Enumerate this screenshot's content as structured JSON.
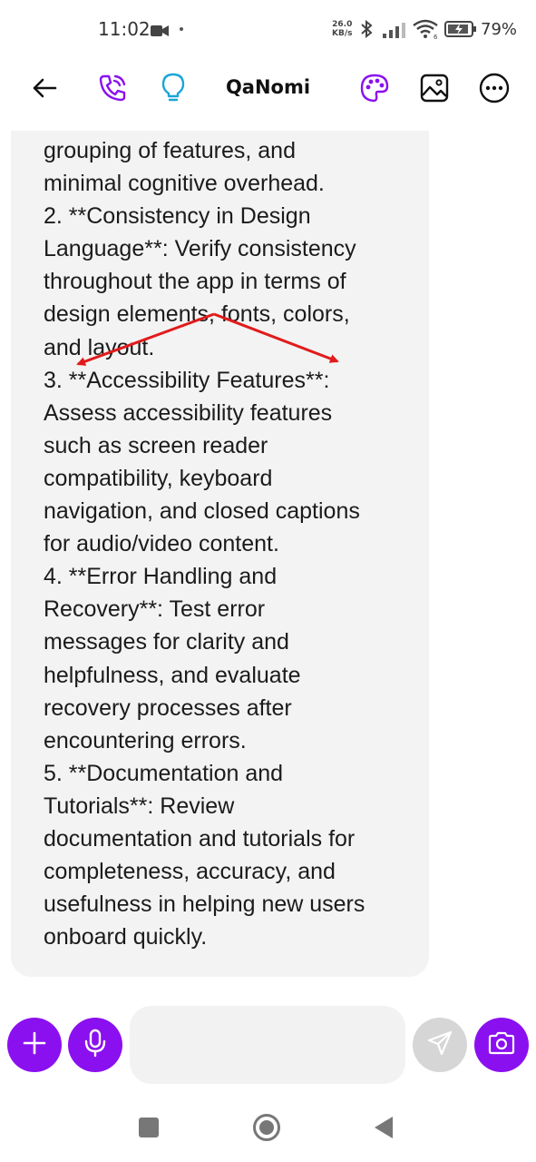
{
  "status_bar": {
    "time": "11:02",
    "net_speed_value": "26.0",
    "net_speed_unit": "KB/s",
    "battery_percent": "79%"
  },
  "app_bar": {
    "title": "QaNomi",
    "icons": [
      "back-arrow-icon",
      "phone-call-icon",
      "lightbulb-icon",
      "palette-icon",
      "image-icon",
      "more-options-icon"
    ],
    "accent_color": "#8b10f0",
    "bulb_color": "#18a6d8"
  },
  "message": {
    "lines": [
      "grouping of features, and",
      "minimal cognitive overhead.",
      "2. **Consistency in Design",
      "Language**: Verify consistency",
      "throughout the app in terms of",
      "design elements, fonts, colors,",
      "and layout.",
      "3. **Accessibility Features**:",
      "Assess accessibility features",
      "such as screen reader",
      "compatibility, keyboard",
      "navigation, and closed captions",
      "for audio/video content.",
      "4. **Error Handling and",
      "Recovery**: Test error",
      "messages for clarity and",
      "helpfulness, and evaluate",
      "recovery processes after",
      "encountering errors.",
      "5. **Documentation and",
      "Tutorials**: Review",
      "documentation and tutorials for",
      "completeness, accuracy, and",
      "usefulness in helping new users",
      "onboard quickly."
    ],
    "annotation_color": "#e11b1b"
  },
  "input_bar": {
    "placeholder": "",
    "icons": [
      "plus-icon",
      "microphone-icon",
      "send-icon",
      "camera-icon"
    ]
  },
  "nav_bar": {
    "icons": [
      "recents-square-icon",
      "home-circle-icon",
      "back-triangle-icon"
    ]
  }
}
